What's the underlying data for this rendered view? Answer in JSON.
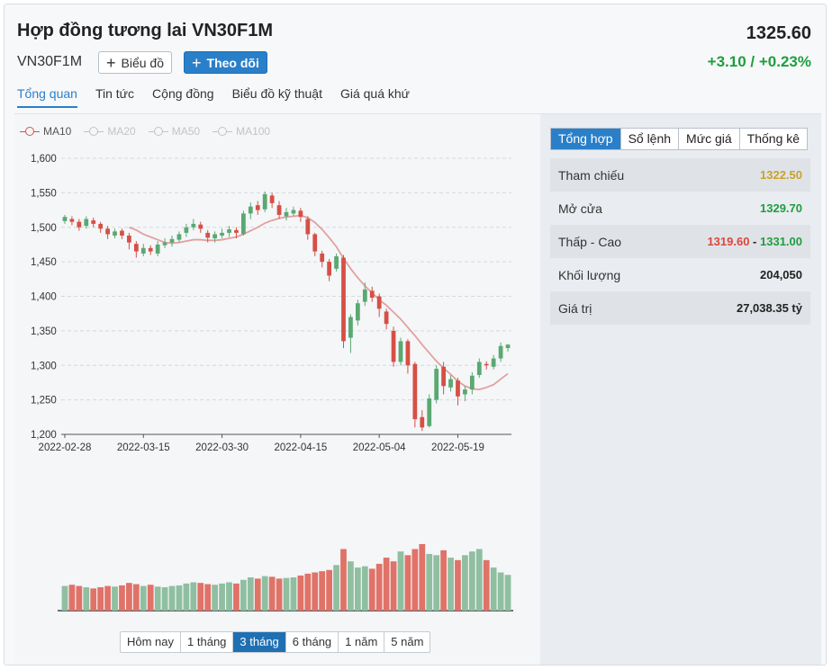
{
  "header": {
    "title": "Hợp đồng tương lai VN30F1M",
    "symbol": "VN30F1M",
    "price": "1325.60",
    "change": "+3.10 / +0.23%",
    "chart_button": "Biểu đồ",
    "follow_button": "Theo dõi"
  },
  "tabs": [
    "Tổng quan",
    "Tin tức",
    "Cộng đồng",
    "Biểu đồ kỹ thuật",
    "Giá quá khứ"
  ],
  "legend": [
    {
      "label": "MA10",
      "color": "#d9534f",
      "active": true
    },
    {
      "label": "MA20",
      "color": "#bbbbbb",
      "active": false
    },
    {
      "label": "MA50",
      "color": "#bbbbbb",
      "active": false
    },
    {
      "label": "MA100",
      "color": "#bbbbbb",
      "active": false
    }
  ],
  "range_buttons": [
    "Hôm nay",
    "1 tháng",
    "3 tháng",
    "6 tháng",
    "1 năm",
    "5 năm"
  ],
  "range_active": "3 tháng",
  "side": {
    "subtabs": [
      "Tổng hợp",
      "Sổ lệnh",
      "Mức giá",
      "Thống kê"
    ],
    "rows": [
      {
        "label": "Tham chiếu",
        "value": "1322.50",
        "color": "#c9a227"
      },
      {
        "label": "Mở cửa",
        "value": "1329.70",
        "color": "#1e9e3e"
      },
      {
        "label": "Thấp - Cao",
        "low": "1319.60",
        "sep": " - ",
        "high": "1331.00"
      },
      {
        "label": "Khối lượng",
        "value": "204,050",
        "color": "#222222"
      },
      {
        "label": "Giá trị",
        "value": "27,038.35 tỷ",
        "color": "#222222"
      }
    ]
  },
  "colors": {
    "up": "#8fbfa0",
    "down": "#e07268",
    "up_candle": "#5aa872",
    "down_candle": "#d64f45",
    "ma": "#e3a0a0",
    "accent": "#2a7fc9"
  },
  "chart_data": {
    "type": "candlestick",
    "y_ticks": [
      "1,600",
      "1,550",
      "1,500",
      "1,450",
      "1,400",
      "1,350",
      "1,300",
      "1,250",
      "1,200"
    ],
    "ylim": [
      1200,
      1600
    ],
    "x_ticks": [
      "2022-02-28",
      "2022-03-15",
      "2022-03-30",
      "2022-04-15",
      "2022-05-04",
      "2022-05-19"
    ],
    "x_tick_index": [
      0,
      11,
      22,
      33,
      44,
      55
    ],
    "candles": [
      [
        1509,
        1515,
        1505,
        1518
      ],
      [
        1512,
        1508,
        1503,
        1516
      ],
      [
        1508,
        1500,
        1495,
        1512
      ],
      [
        1502,
        1512,
        1498,
        1516
      ],
      [
        1510,
        1505,
        1500,
        1514
      ],
      [
        1505,
        1498,
        1492,
        1508
      ],
      [
        1498,
        1490,
        1483,
        1502
      ],
      [
        1488,
        1494,
        1484,
        1498
      ],
      [
        1495,
        1488,
        1483,
        1498
      ],
      [
        1488,
        1478,
        1468,
        1492
      ],
      [
        1476,
        1465,
        1456,
        1480
      ],
      [
        1462,
        1470,
        1458,
        1476
      ],
      [
        1470,
        1465,
        1460,
        1474
      ],
      [
        1462,
        1475,
        1458,
        1480
      ],
      [
        1474,
        1478,
        1470,
        1484
      ],
      [
        1478,
        1483,
        1472,
        1488
      ],
      [
        1482,
        1490,
        1478,
        1494
      ],
      [
        1492,
        1500,
        1486,
        1505
      ],
      [
        1500,
        1505,
        1496,
        1512
      ],
      [
        1504,
        1498,
        1492,
        1508
      ],
      [
        1492,
        1485,
        1478,
        1496
      ],
      [
        1484,
        1490,
        1478,
        1494
      ],
      [
        1488,
        1492,
        1484,
        1498
      ],
      [
        1492,
        1497,
        1486,
        1502
      ],
      [
        1496,
        1492,
        1484,
        1500
      ],
      [
        1490,
        1520,
        1488,
        1524
      ],
      [
        1520,
        1530,
        1512,
        1536
      ],
      [
        1532,
        1525,
        1518,
        1538
      ],
      [
        1526,
        1548,
        1522,
        1552
      ],
      [
        1546,
        1535,
        1528,
        1550
      ],
      [
        1532,
        1518,
        1512,
        1538
      ],
      [
        1516,
        1522,
        1510,
        1528
      ],
      [
        1520,
        1525,
        1516,
        1530
      ],
      [
        1524,
        1515,
        1508,
        1528
      ],
      [
        1512,
        1490,
        1482,
        1516
      ],
      [
        1490,
        1465,
        1458,
        1492
      ],
      [
        1462,
        1450,
        1442,
        1466
      ],
      [
        1450,
        1430,
        1422,
        1454
      ],
      [
        1440,
        1458,
        1436,
        1462
      ],
      [
        1456,
        1335,
        1325,
        1460
      ],
      [
        1340,
        1370,
        1318,
        1374
      ],
      [
        1365,
        1390,
        1358,
        1395
      ],
      [
        1392,
        1410,
        1386,
        1420
      ],
      [
        1408,
        1398,
        1392,
        1414
      ],
      [
        1400,
        1382,
        1370,
        1404
      ],
      [
        1378,
        1360,
        1352,
        1382
      ],
      [
        1350,
        1305,
        1298,
        1356
      ],
      [
        1305,
        1335,
        1300,
        1340
      ],
      [
        1335,
        1300,
        1288,
        1338
      ],
      [
        1302,
        1222,
        1210,
        1305
      ],
      [
        1225,
        1210,
        1205,
        1235
      ],
      [
        1212,
        1252,
        1210,
        1258
      ],
      [
        1250,
        1295,
        1245,
        1300
      ],
      [
        1298,
        1270,
        1258,
        1305
      ],
      [
        1268,
        1280,
        1262,
        1286
      ],
      [
        1278,
        1255,
        1242,
        1282
      ],
      [
        1258,
        1265,
        1248,
        1270
      ],
      [
        1265,
        1285,
        1258,
        1290
      ],
      [
        1286,
        1305,
        1282,
        1310
      ],
      [
        1302,
        1300,
        1294,
        1306
      ],
      [
        1298,
        1310,
        1294,
        1315
      ],
      [
        1310,
        1328,
        1305,
        1333
      ],
      [
        1325,
        1330,
        1320,
        1331
      ]
    ],
    "ma10": [
      null,
      null,
      null,
      null,
      null,
      null,
      null,
      null,
      null,
      1500,
      1496,
      1490,
      1486,
      1482,
      1478,
      1477,
      1478,
      1480,
      1482,
      1482,
      1481,
      1481,
      1482,
      1484,
      1486,
      1490,
      1495,
      1500,
      1506,
      1510,
      1513,
      1515,
      1516,
      1517,
      1514,
      1507,
      1497,
      1485,
      1472,
      1455,
      1440,
      1427,
      1415,
      1405,
      1395,
      1387,
      1377,
      1367,
      1355,
      1343,
      1330,
      1318,
      1306,
      1296,
      1287,
      1277,
      1270,
      1266,
      1265,
      1268,
      1272,
      1280,
      1288
    ],
    "volume": [
      40,
      42,
      40,
      38,
      36,
      38,
      40,
      39,
      41,
      45,
      43,
      40,
      42,
      39,
      38,
      40,
      41,
      44,
      46,
      45,
      43,
      42,
      44,
      46,
      44,
      50,
      54,
      52,
      56,
      55,
      52,
      53,
      54,
      57,
      60,
      62,
      64,
      66,
      74,
      100,
      80,
      70,
      72,
      68,
      76,
      86,
      80,
      96,
      90,
      100,
      108,
      92,
      90,
      98,
      86,
      82,
      90,
      96,
      100,
      82,
      70,
      62,
      58
    ]
  }
}
